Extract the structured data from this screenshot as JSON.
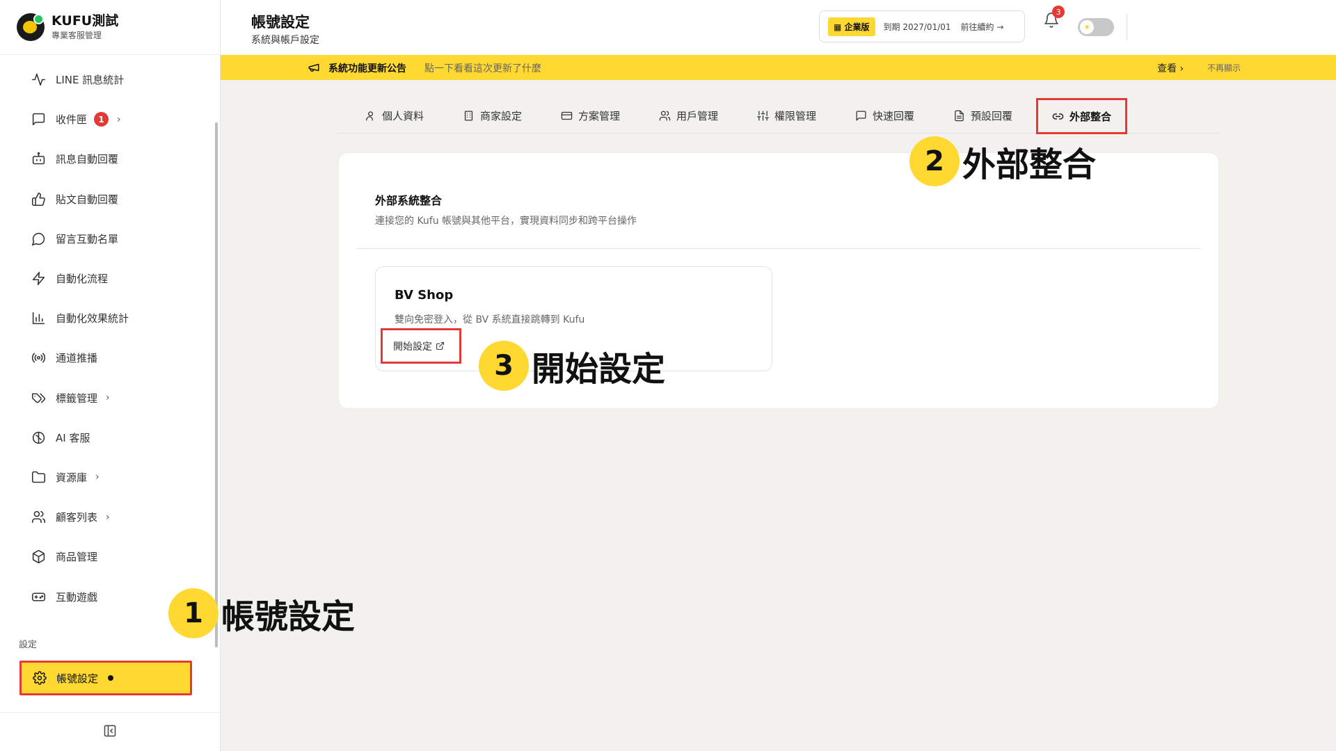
{
  "brand": {
    "name": "KUFU測試",
    "subtitle": "專業客服管理"
  },
  "sidebar": {
    "items": [
      {
        "label": "LINE 訊息統計",
        "icon": "activity-icon"
      },
      {
        "label": "收件匣",
        "icon": "message-square-icon",
        "badge": "1",
        "has_chevron": true
      },
      {
        "label": "訊息自動回覆",
        "icon": "bot-icon"
      },
      {
        "label": "貼文自動回覆",
        "icon": "thumbs-up-icon"
      },
      {
        "label": "留言互動名單",
        "icon": "message-circle-icon"
      },
      {
        "label": "自動化流程",
        "icon": "zap-icon"
      },
      {
        "label": "自動化效果統計",
        "icon": "bar-chart-icon"
      },
      {
        "label": "通道推播",
        "icon": "radio-icon"
      },
      {
        "label": "標籤管理",
        "icon": "tags-icon",
        "has_chevron": true
      },
      {
        "label": "AI 客服",
        "icon": "brain-icon"
      },
      {
        "label": "資源庫",
        "icon": "folder-icon",
        "has_chevron": true
      },
      {
        "label": "顧客列表",
        "icon": "users-icon",
        "has_chevron": true
      },
      {
        "label": "商品管理",
        "icon": "package-icon"
      },
      {
        "label": "互動遊戲",
        "icon": "gamepad-icon"
      }
    ],
    "section_label": "設定",
    "active_item": {
      "label": "帳號設定",
      "icon": "gear-icon"
    }
  },
  "header": {
    "title": "帳號設定",
    "subtitle": "系統與帳戶設定",
    "plan_tag": "企業版",
    "expire": "到期 2027/01/01",
    "renew": "前往續約 →",
    "notification_count": "3"
  },
  "announcement": {
    "title": "系統功能更新公告",
    "text": "點一下看看這次更新了什麼",
    "view": "查看",
    "hide": "不再顯示"
  },
  "tabs": [
    {
      "label": "個人資料",
      "icon": "user-icon"
    },
    {
      "label": "商家設定",
      "icon": "building-icon"
    },
    {
      "label": "方案管理",
      "icon": "credit-card-icon"
    },
    {
      "label": "用戶管理",
      "icon": "users-icon"
    },
    {
      "label": "權限管理",
      "icon": "sliders-icon"
    },
    {
      "label": "快速回覆",
      "icon": "message-square-icon"
    },
    {
      "label": "預設回覆",
      "icon": "file-text-icon"
    },
    {
      "label": "外部整合",
      "icon": "link-icon",
      "active": true
    }
  ],
  "main": {
    "section_title": "外部系統整合",
    "section_desc": "連接您的 Kufu 帳號與其他平台，實現資料同步和跨平台操作",
    "integration": {
      "title": "BV Shop",
      "desc": "雙向免密登入，從 BV 系統直接跳轉到 Kufu",
      "button": "開始設定"
    }
  },
  "annotations": [
    {
      "num": "1",
      "text": "帳號設定"
    },
    {
      "num": "2",
      "text": "外部整合"
    },
    {
      "num": "3",
      "text": "開始設定"
    }
  ],
  "colors": {
    "accent": "#ffd831",
    "highlight": "#e53935",
    "badge": "#e53935"
  }
}
